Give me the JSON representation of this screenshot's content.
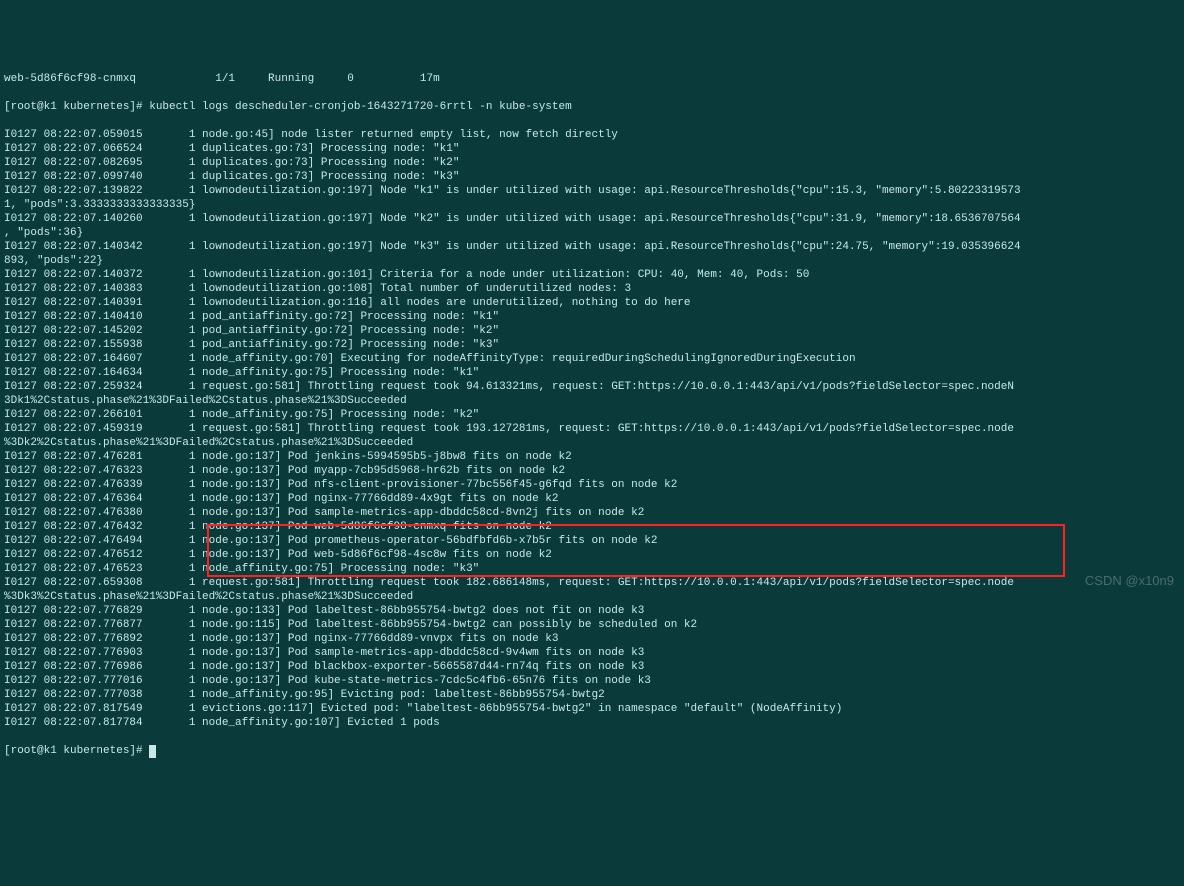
{
  "prompt": "[root@k1 kubernetes]# ",
  "command": "kubectl logs descheduler-cronjob-1643271720-6rrtl -n kube-system",
  "lines": [
    "I0127 08:22:07.059015       1 node.go:45] node lister returned empty list, now fetch directly",
    "I0127 08:22:07.066524       1 duplicates.go:73] Processing node: \"k1\"",
    "I0127 08:22:07.082695       1 duplicates.go:73] Processing node: \"k2\"",
    "I0127 08:22:07.099740       1 duplicates.go:73] Processing node: \"k3\"",
    "I0127 08:22:07.139822       1 lownodeutilization.go:197] Node \"k1\" is under utilized with usage: api.ResourceThresholds{\"cpu\":15.3, \"memory\":5.80223319573",
    "1, \"pods\":3.3333333333333335}",
    "I0127 08:22:07.140260       1 lownodeutilization.go:197] Node \"k2\" is under utilized with usage: api.ResourceThresholds{\"cpu\":31.9, \"memory\":18.6536707564",
    ", \"pods\":36}",
    "I0127 08:22:07.140342       1 lownodeutilization.go:197] Node \"k3\" is under utilized with usage: api.ResourceThresholds{\"cpu\":24.75, \"memory\":19.035396624",
    "893, \"pods\":22}",
    "I0127 08:22:07.140372       1 lownodeutilization.go:101] Criteria for a node under utilization: CPU: 40, Mem: 40, Pods: 50",
    "I0127 08:22:07.140383       1 lownodeutilization.go:108] Total number of underutilized nodes: 3",
    "I0127 08:22:07.140391       1 lownodeutilization.go:116] all nodes are underutilized, nothing to do here",
    "I0127 08:22:07.140410       1 pod_antiaffinity.go:72] Processing node: \"k1\"",
    "I0127 08:22:07.145202       1 pod_antiaffinity.go:72] Processing node: \"k2\"",
    "I0127 08:22:07.155938       1 pod_antiaffinity.go:72] Processing node: \"k3\"",
    "I0127 08:22:07.164607       1 node_affinity.go:70] Executing for nodeAffinityType: requiredDuringSchedulingIgnoredDuringExecution",
    "I0127 08:22:07.164634       1 node_affinity.go:75] Processing node: \"k1\"",
    "I0127 08:22:07.259324       1 request.go:581] Throttling request took 94.613321ms, request: GET:https://10.0.0.1:443/api/v1/pods?fieldSelector=spec.nodeN",
    "3Dk1%2Cstatus.phase%21%3DFailed%2Cstatus.phase%21%3DSucceeded",
    "I0127 08:22:07.266101       1 node_affinity.go:75] Processing node: \"k2\"",
    "I0127 08:22:07.459319       1 request.go:581] Throttling request took 193.127281ms, request: GET:https://10.0.0.1:443/api/v1/pods?fieldSelector=spec.node",
    "%3Dk2%2Cstatus.phase%21%3DFailed%2Cstatus.phase%21%3DSucceeded",
    "I0127 08:22:07.476281       1 node.go:137] Pod jenkins-5994595b5-j8bw8 fits on node k2",
    "I0127 08:22:07.476323       1 node.go:137] Pod myapp-7cb95d5968-hr62b fits on node k2",
    "I0127 08:22:07.476339       1 node.go:137] Pod nfs-client-provisioner-77bc556f45-g6fqd fits on node k2",
    "I0127 08:22:07.476364       1 node.go:137] Pod nginx-77766dd89-4x9gt fits on node k2",
    "I0127 08:22:07.476380       1 node.go:137] Pod sample-metrics-app-dbddc58cd-8vn2j fits on node k2",
    "I0127 08:22:07.476432       1 node.go:137] Pod web-5d86f6cf98-cnmxq fits on node k2",
    "I0127 08:22:07.476494       1 node.go:137] Pod prometheus-operator-56bdfbfd6b-x7b5r fits on node k2",
    "I0127 08:22:07.476512       1 node.go:137] Pod web-5d86f6cf98-4sc8w fits on node k2",
    "I0127 08:22:07.476523       1 node_affinity.go:75] Processing node: \"k3\"",
    "I0127 08:22:07.659308       1 request.go:581] Throttling request took 182.686148ms, request: GET:https://10.0.0.1:443/api/v1/pods?fieldSelector=spec.node",
    "%3Dk3%2Cstatus.phase%21%3DFailed%2Cstatus.phase%21%3DSucceeded",
    "I0127 08:22:07.776829       1 node.go:133] Pod labeltest-86bb955754-bwtg2 does not fit on node k3",
    "I0127 08:22:07.776877       1 node.go:115] Pod labeltest-86bb955754-bwtg2 can possibly be scheduled on k2",
    "I0127 08:22:07.776892       1 node.go:137] Pod nginx-77766dd89-vnvpx fits on node k3",
    "I0127 08:22:07.776903       1 node.go:137] Pod sample-metrics-app-dbddc58cd-9v4wm fits on node k3",
    "I0127 08:22:07.776986       1 node.go:137] Pod blackbox-exporter-5665587d44-rn74q fits on node k3",
    "I0127 08:22:07.777016       1 node.go:137] Pod kube-state-metrics-7cdc5c4fb6-65n76 fits on node k3",
    "I0127 08:22:07.777038       1 node_affinity.go:95] Evicting pod: labeltest-86bb955754-bwtg2",
    "I0127 08:22:07.817549       1 evictions.go:117] Evicted pod: \"labeltest-86bb955754-bwtg2\" in namespace \"default\" (NodeAffinity)",
    "I0127 08:22:07.817784       1 node_affinity.go:107] Evicted 1 pods"
  ],
  "end_prompt": "[root@k1 kubernetes]# ",
  "highlight_lines": [
    39,
    40,
    41,
    42
  ],
  "watermark": "CSDN @x10n9"
}
